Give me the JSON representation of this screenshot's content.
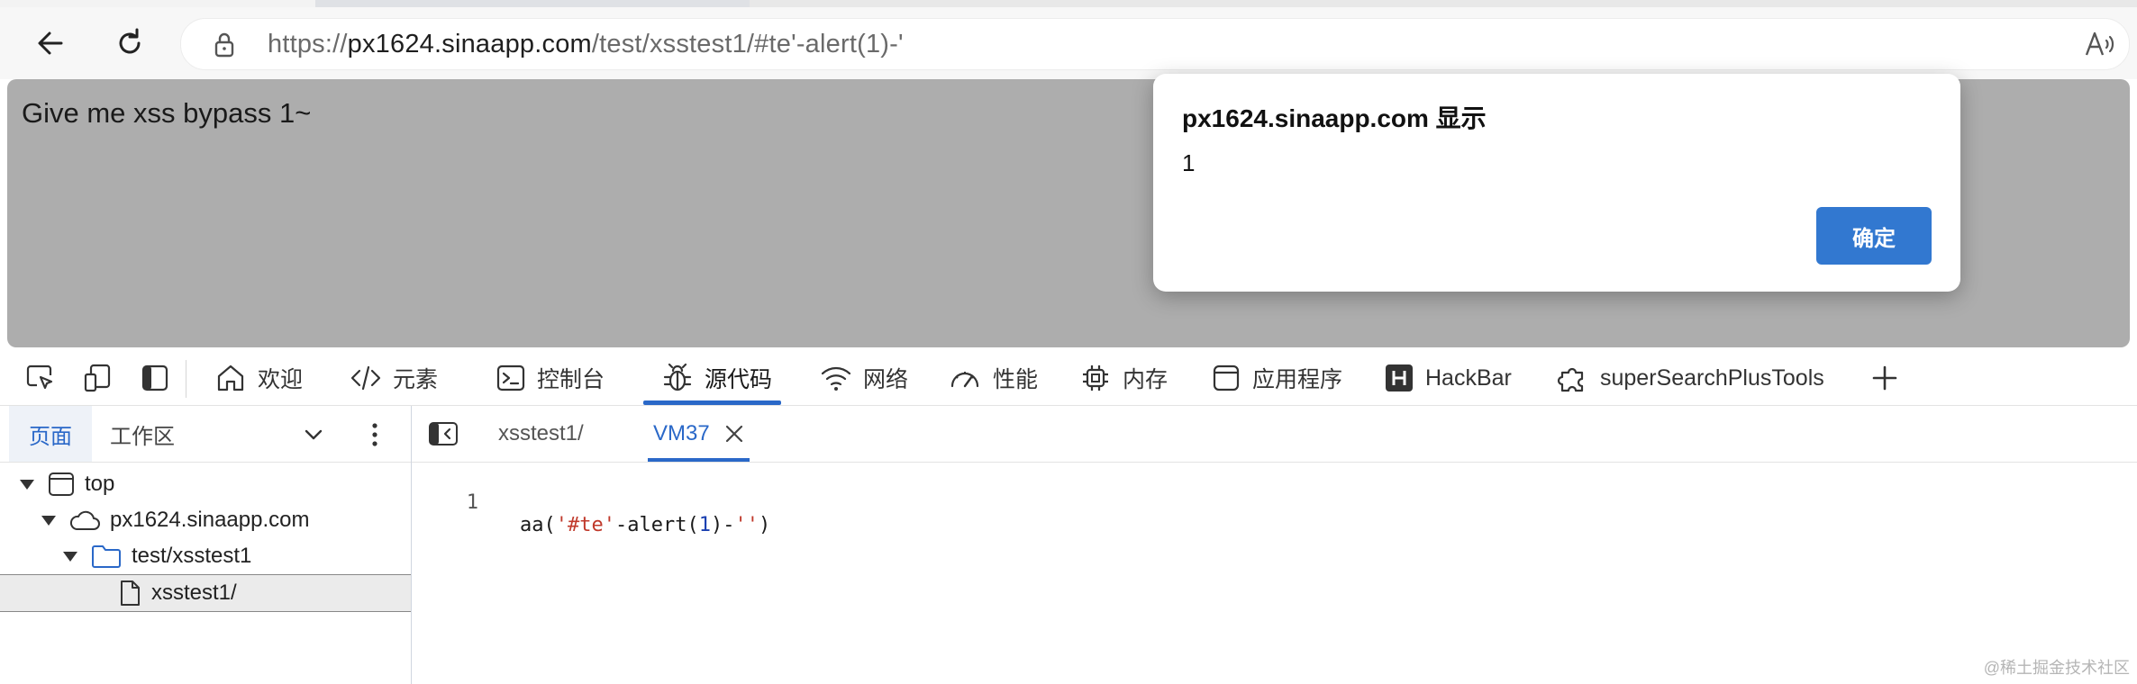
{
  "browser": {
    "url_prefix": "https://",
    "url_host": "px1624.sinaapp.com",
    "url_path": "/test/xsstest1/#te'-alert(1)-'",
    "icons": [
      "back-arrow-icon",
      "refresh-icon",
      "lock-icon",
      "read-aloud-icon"
    ]
  },
  "page": {
    "body_text": "Give me xss bypass 1~"
  },
  "alert_dialog": {
    "title": "px1624.sinaapp.com 显示",
    "message": "1",
    "ok_label": "确定",
    "ok_color": "#3278d0"
  },
  "devtools": {
    "tabs": [
      {
        "label": "欢迎",
        "icon": "home-icon"
      },
      {
        "label": "元素",
        "icon": "code-tag-icon"
      },
      {
        "label": "控制台",
        "icon": "console-icon"
      },
      {
        "label": "源代码",
        "icon": "bug-icon",
        "active": true
      },
      {
        "label": "网络",
        "icon": "wifi-icon"
      },
      {
        "label": "性能",
        "icon": "gauge-icon"
      },
      {
        "label": "内存",
        "icon": "chip-icon"
      },
      {
        "label": "应用程序",
        "icon": "app-window-icon"
      },
      {
        "label": "HackBar",
        "icon": "hackbar-h-icon"
      },
      {
        "label": "superSearchPlusTools",
        "icon": "puzzle-icon"
      }
    ],
    "accent_color": "#2a68c8",
    "navigator": {
      "tab_pages": "页面",
      "tab_workspace": "工作区",
      "tree": [
        {
          "label": "top",
          "icon": "frame-icon"
        },
        {
          "label": "px1624.sinaapp.com",
          "icon": "cloud-icon"
        },
        {
          "label": "test/xsstest1",
          "icon": "folder-icon"
        },
        {
          "label": "xsstest1/",
          "icon": "file-icon",
          "selected": true
        }
      ]
    },
    "editor": {
      "tabs": [
        {
          "label": "xsstest1/"
        },
        {
          "label": "VM37",
          "active": true
        }
      ],
      "line_number": "1",
      "code": {
        "t1": "aa(",
        "t2": "'#te'",
        "t3": "-alert(",
        "t4": "1",
        "t5": ")-",
        "t6": "''",
        "t7": ")"
      }
    }
  },
  "watermark": "@稀土掘金技术社区"
}
